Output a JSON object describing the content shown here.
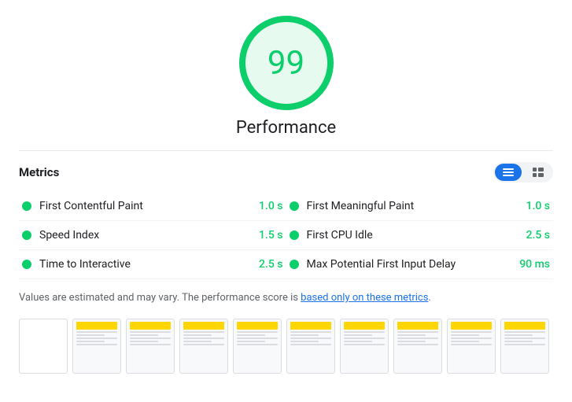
{
  "score": {
    "value": "99",
    "label": "Performance"
  },
  "metrics_header": {
    "title": "Metrics",
    "toggle": {
      "list_label": "≡",
      "grid_label": "⊞"
    }
  },
  "metrics": [
    {
      "name": "First Contentful Paint",
      "value": "1.0 s",
      "dot_color": "#0cce6b"
    },
    {
      "name": "First Meaningful Paint",
      "value": "1.0 s",
      "dot_color": "#0cce6b"
    },
    {
      "name": "Speed Index",
      "value": "1.5 s",
      "dot_color": "#0cce6b"
    },
    {
      "name": "First CPU Idle",
      "value": "2.5 s",
      "dot_color": "#0cce6b"
    },
    {
      "name": "Time to Interactive",
      "value": "2.5 s",
      "dot_color": "#0cce6b"
    },
    {
      "name": "Max Potential First Input Delay",
      "value": "90 ms",
      "dot_color": "#0cce6b"
    }
  ],
  "note": {
    "text_before": "Values are estimated and may vary. The performance score is ",
    "link_text": "based only on these metrics",
    "text_after": "."
  },
  "filmstrip": {
    "frames": [
      0,
      1,
      2,
      3,
      4,
      5,
      6,
      7,
      8,
      9,
      10
    ]
  }
}
